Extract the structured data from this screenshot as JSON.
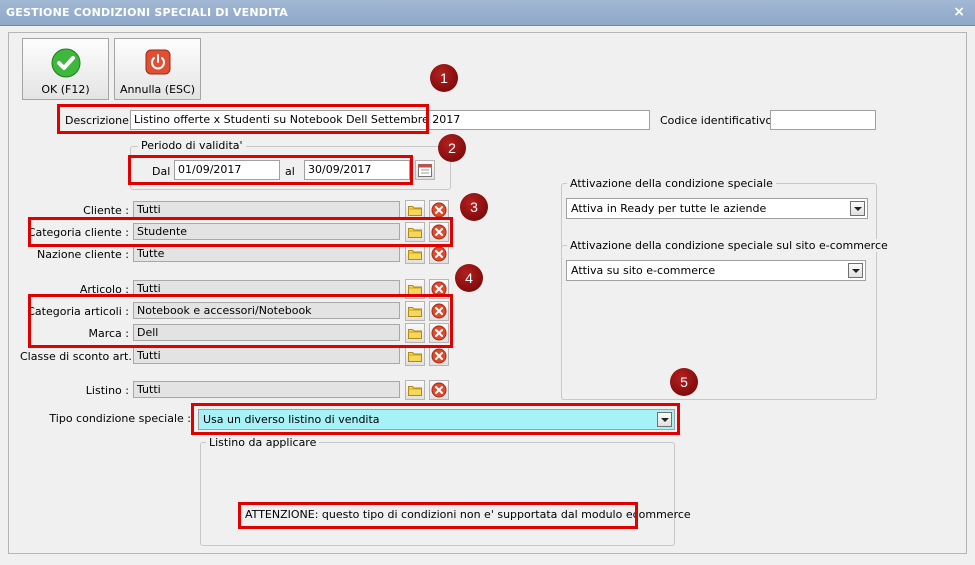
{
  "window": {
    "title": "GESTIONE CONDIZIONI SPECIALI DI VENDITA",
    "close": "×"
  },
  "toolbar": {
    "ok_label": "OK (F12)",
    "cancel_label": "Annulla (ESC)"
  },
  "descrizione": {
    "label": "Descrizione :",
    "value": "Listino offerte x Studenti su Notebook Dell Settembre 2017"
  },
  "codice": {
    "label": "Codice identificativo :",
    "value": ""
  },
  "periodo": {
    "title": "Periodo di validita'",
    "dal_label": "Dal",
    "dal_value": "01/09/2017",
    "al_label": "al",
    "al_value": "30/09/2017"
  },
  "fields": {
    "cliente": {
      "label": "Cliente :",
      "value": "Tutti"
    },
    "categoria_cliente": {
      "label": "Categoria cliente :",
      "value": "Studente"
    },
    "nazione_cliente": {
      "label": "Nazione cliente :",
      "value": "Tutte"
    },
    "articolo": {
      "label": "Articolo :",
      "value": "Tutti"
    },
    "categoria_articoli": {
      "label": "Categoria articoli :",
      "value": "Notebook e accessori/Notebook"
    },
    "marca": {
      "label": "Marca :",
      "value": "Dell"
    },
    "classe_sconto": {
      "label": "Classe di sconto art. :",
      "value": "Tutti"
    },
    "listino": {
      "label": "Listino :",
      "value": "Tutti"
    }
  },
  "tipo_condizione": {
    "label": "Tipo condizione speciale :",
    "value": "Usa un diverso listino di vendita"
  },
  "listino_applicare": {
    "title": "Listino da applicare",
    "warning": "ATTENZIONE: questo tipo di condizioni non e' supportata dal modulo ecommerce"
  },
  "attivazione": {
    "title": "Attivazione della condizione speciale",
    "value": "Attiva in Ready per tutte le aziende"
  },
  "attivazione_web": {
    "title": "Attivazione della condizione speciale sul sito e-commerce",
    "value": "Attiva su sito e-commerce"
  },
  "badges": [
    "1",
    "2",
    "3",
    "4",
    "5"
  ],
  "colors": {
    "accent_red": "#e00000",
    "badge": "#8b0a0a",
    "highlight_combo": "#a6f2f7",
    "ok_green": "#3db83d",
    "cancel_red": "#e04e33"
  }
}
